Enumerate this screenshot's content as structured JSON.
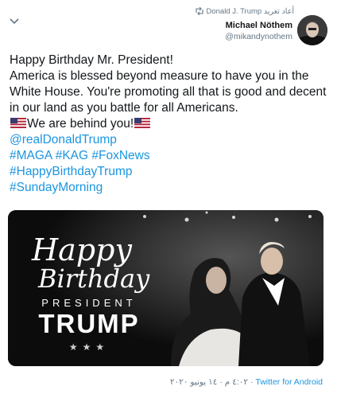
{
  "header": {
    "retweet_label": "أعاد تغريد",
    "retweeter": "Donald J. Trump",
    "author_name": "Michael Nöthem",
    "author_handle": "@mikandynothem"
  },
  "tweet": {
    "line1": "Happy Birthday Mr. President!",
    "line2": "America is blessed beyond measure to have you in the White House. You're promoting all that is good and decent in our land as you battle for all Americans.",
    "line3": "We are behind you!",
    "mention": "@realDonaldTrump",
    "hashtags_line1": "#MAGA #KAG #FoxNews",
    "hashtag_birthday": "#HappyBirthdayTrump",
    "hashtag_sunday": "#SundayMorning"
  },
  "media": {
    "happy": "Happy",
    "birthday": "Birthday",
    "president": "PRESIDENT",
    "trump": "TRUMP",
    "stars": "★★★"
  },
  "meta": {
    "timestamp": "٤:٠٢ م · ١٤ يونيو ٢٠٢٠ ·",
    "source": "Twitter for Android"
  }
}
